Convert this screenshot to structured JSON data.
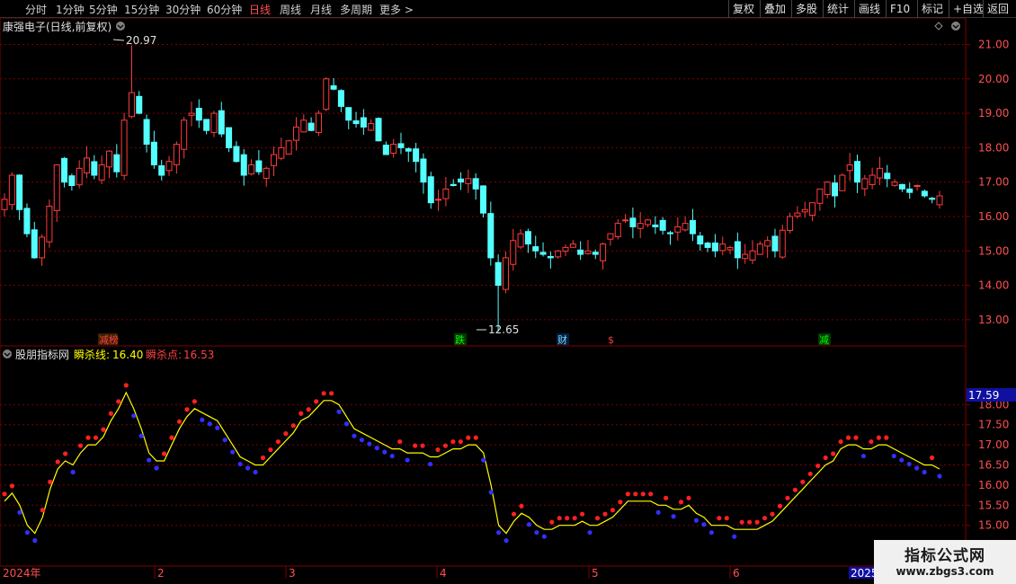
{
  "toolbar": {
    "periods": [
      "分时",
      "1分钟",
      "5分钟",
      "15分钟",
      "30分钟",
      "60分钟",
      "日线",
      "周线",
      "月线",
      "多周期",
      "更多 >"
    ],
    "active_period": "日线",
    "actions": [
      "复权",
      "叠加",
      "多股",
      "统计",
      "画线",
      "F10",
      "标记",
      "+自选",
      "返回"
    ]
  },
  "main_panel": {
    "title": "康强电子(日线,前复权)",
    "high_label": "20.97",
    "low_label": "12.65",
    "y_ticks": [
      "21.00",
      "20.00",
      "19.00",
      "18.00",
      "17.00",
      "16.00",
      "15.00",
      "14.00",
      "13.00"
    ],
    "signals": [
      {
        "text": "减榜",
        "color": "#ff4040",
        "bg": "#3a2000"
      },
      {
        "text": "跌",
        "color": "#00ff00",
        "bg": "#003a00"
      },
      {
        "text": "财",
        "color": "#7fd4ff",
        "bg": "#002040"
      },
      {
        "text": "$",
        "color": "#ff4040",
        "bg": "#000000"
      },
      {
        "text": "减",
        "color": "#00ff00",
        "bg": "#003a00"
      }
    ]
  },
  "indicator_panel": {
    "name": "股朋指标网",
    "line_label": "瞬杀线:",
    "line_value": "16.40",
    "point_label": "瞬杀点:",
    "point_value": "16.53",
    "current_price": "17.59",
    "y_ticks": [
      "18.00",
      "17.50",
      "17.00",
      "16.50",
      "16.00",
      "15.50",
      "15.00"
    ]
  },
  "x_axis": {
    "labels": [
      "2024年",
      "2",
      "3",
      "4",
      "5",
      "6",
      "2025"
    ]
  },
  "watermark": {
    "title": "指标公式网",
    "url": "www.zbgs3.com"
  },
  "colors": {
    "up": "#ff3c3c",
    "down": "#54ffff",
    "indicator_line": "#ffff00",
    "dot_high": "#ff2020",
    "dot_low": "#3030ff",
    "grid": "#800000"
  },
  "chart_data": {
    "type": "candlestick",
    "closes": [
      16.5,
      17.2,
      16.2,
      15.5,
      14.8,
      15.4,
      16.3,
      17.5,
      17.0,
      16.9,
      17.4,
      17.7,
      17.2,
      17.5,
      17.9,
      17.3,
      18.8,
      19.6,
      19.0,
      18.1,
      17.5,
      17.2,
      17.6,
      18.1,
      18.8,
      19.0,
      18.8,
      18.5,
      19.0,
      18.4,
      18.0,
      17.6,
      17.2,
      17.5,
      17.3,
      17.4,
      17.8,
      18.0,
      18.2,
      18.6,
      18.8,
      18.5,
      19.0,
      20.0,
      19.7,
      19.2,
      18.8,
      18.7,
      18.6,
      18.7,
      18.2,
      17.8,
      18.1,
      18.0,
      17.9,
      17.6,
      17.0,
      16.4,
      16.5,
      16.8,
      16.9,
      17.0,
      17.1,
      16.8,
      16.1,
      14.8,
      14.0,
      14.8,
      15.3,
      15.5,
      15.2,
      15.0,
      14.9,
      14.8,
      15.0,
      15.1,
      15.2,
      14.9,
      15.0,
      14.9,
      15.2,
      15.5,
      15.8,
      15.9,
      15.7,
      15.8,
      15.9,
      15.7,
      15.6,
      15.5,
      15.7,
      15.8,
      15.5,
      15.2,
      15.1,
      15.0,
      15.2,
      15.1,
      14.8,
      14.9,
      15.0,
      15.2,
      15.3,
      15.0,
      15.6,
      16.0,
      16.1,
      16.2,
      16.4,
      16.8,
      17.0,
      16.6,
      17.2,
      17.5,
      17.0,
      17.1,
      17.2,
      17.4,
      17.1,
      17.0,
      16.8,
      16.7,
      16.9,
      16.6,
      16.5,
      16.6
    ],
    "high": 20.97,
    "low": 12.65,
    "ylim": [
      12.5,
      21.3
    ],
    "indicator": {
      "line": [
        15.6,
        15.8,
        15.5,
        15.0,
        14.8,
        15.2,
        15.9,
        16.4,
        16.6,
        16.5,
        16.8,
        17.0,
        17.0,
        17.2,
        17.6,
        17.9,
        18.3,
        17.9,
        17.4,
        16.8,
        16.6,
        16.6,
        17.0,
        17.4,
        17.7,
        17.9,
        17.8,
        17.7,
        17.6,
        17.3,
        17.0,
        16.7,
        16.6,
        16.5,
        16.5,
        16.7,
        16.9,
        17.1,
        17.3,
        17.6,
        17.7,
        17.9,
        18.1,
        18.1,
        18.0,
        17.7,
        17.4,
        17.3,
        17.2,
        17.1,
        17.0,
        16.9,
        16.9,
        16.8,
        16.8,
        16.8,
        16.7,
        16.7,
        16.8,
        16.9,
        16.9,
        17.0,
        17.0,
        16.8,
        16.0,
        15.0,
        14.8,
        15.1,
        15.3,
        15.2,
        15.0,
        14.9,
        14.9,
        15.0,
        15.0,
        15.0,
        15.1,
        15.0,
        15.0,
        15.1,
        15.2,
        15.4,
        15.6,
        15.6,
        15.6,
        15.6,
        15.5,
        15.5,
        15.4,
        15.4,
        15.5,
        15.3,
        15.2,
        15.0,
        15.0,
        15.0,
        14.9,
        14.9,
        14.9,
        14.9,
        15.0,
        15.1,
        15.3,
        15.5,
        15.7,
        15.9,
        16.1,
        16.3,
        16.5,
        16.6,
        16.9,
        17.0,
        17.0,
        16.9,
        16.9,
        17.0,
        17.0,
        16.9,
        16.8,
        16.7,
        16.6,
        16.5,
        16.5,
        16.4
      ],
      "ylim": [
        14.1,
        18.9
      ]
    }
  }
}
